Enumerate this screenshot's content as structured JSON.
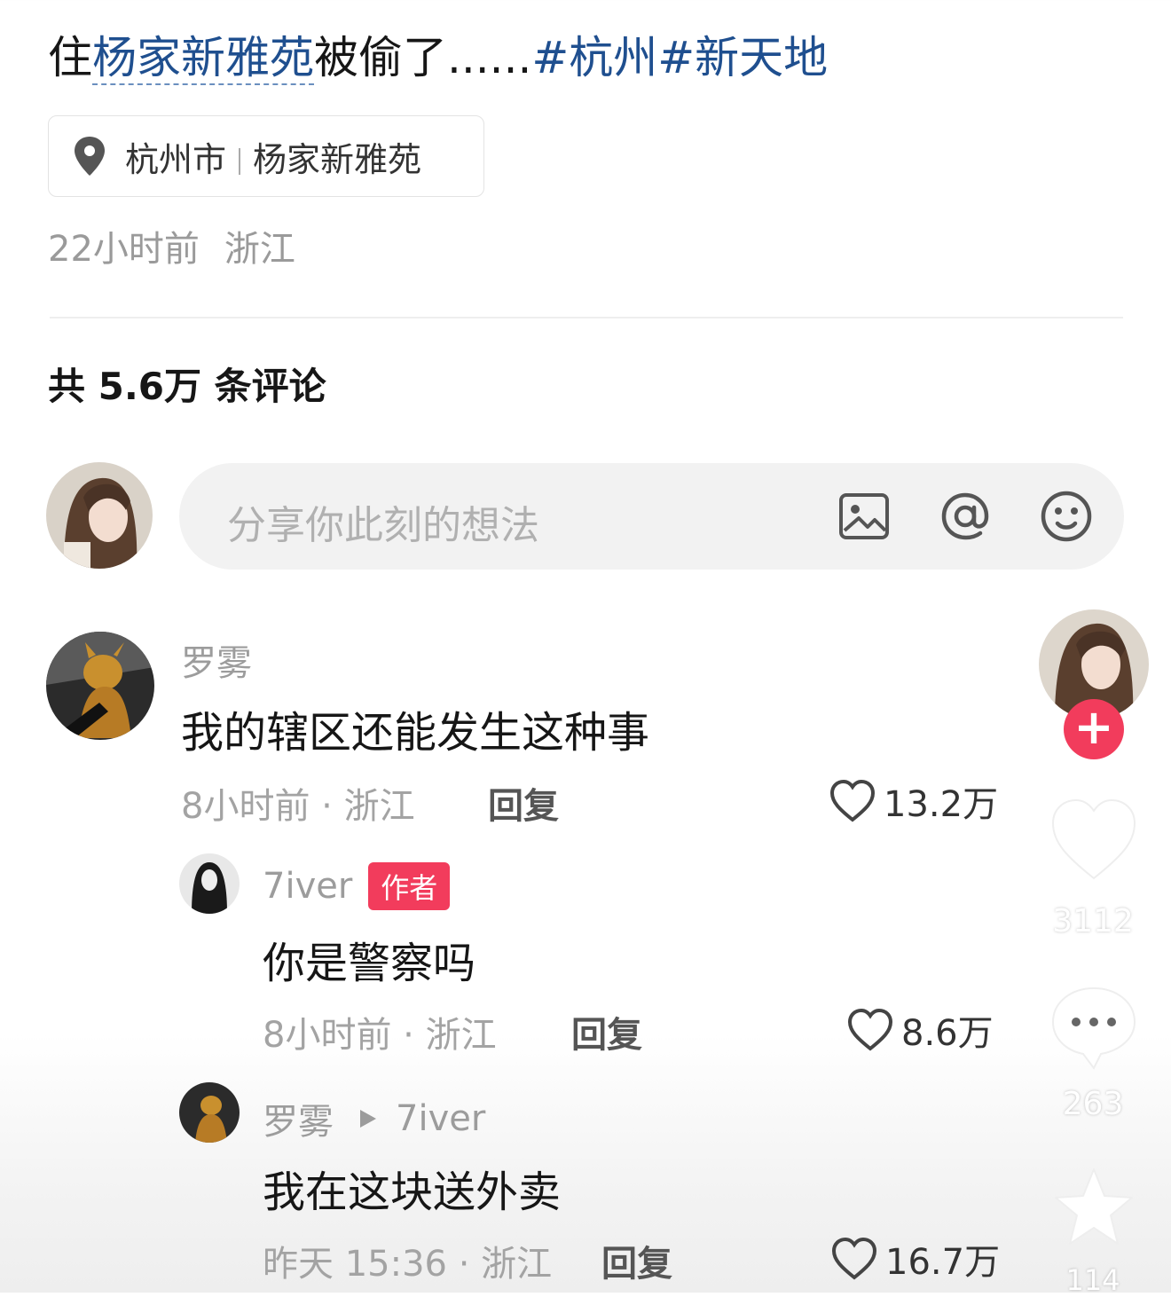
{
  "post": {
    "title_prefix": "住",
    "title_place": "杨家新雅苑",
    "title_rest": "被偷了......",
    "tag1": "#杭州",
    "tag2": "#新天地",
    "location_city": "杭州市",
    "location_place": "杨家新雅苑",
    "time": "22小时前",
    "region": "浙江"
  },
  "comments_header": "共 5.6万 条评论",
  "composer": {
    "placeholder": "分享你此刻的想法",
    "icons": [
      "image-icon",
      "at-icon",
      "emoji-icon"
    ]
  },
  "comments": [
    {
      "user": "罗雾",
      "text": "我的辖区还能发生这种事",
      "meta": "8小时前 · 浙江",
      "reply": "回复",
      "likes": "13.2万"
    },
    {
      "user": "7iver",
      "badge": "作者",
      "text": "你是警察吗",
      "meta": "8小时前 · 浙江",
      "reply": "回复",
      "likes": "8.6万"
    },
    {
      "user": "罗雾",
      "reply_to": "7iver",
      "text": "我在这块送外卖",
      "meta": "昨天 15:36 · 浙江",
      "reply": "回复",
      "likes": "16.7万"
    }
  ],
  "rail": {
    "follow": "+",
    "like_count": "3112",
    "comment_count": "263",
    "fav_count": "114"
  },
  "colors": {
    "accent": "#f23c5c",
    "link": "#1f4f8f"
  }
}
